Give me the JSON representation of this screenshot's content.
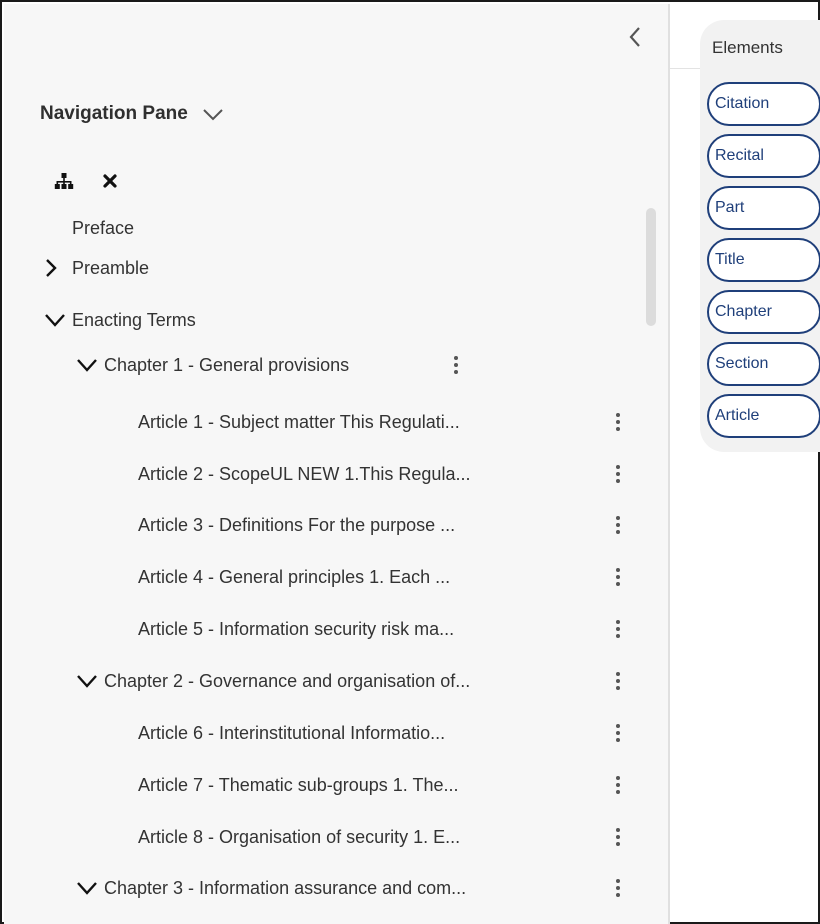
{
  "nav_pane": {
    "title": "Navigation Pane",
    "icons": {
      "collapse": "chevron-left-icon",
      "title_toggle": "chevron-down-icon",
      "structure": "sitemap-icon",
      "close": "close-icon"
    },
    "tree": {
      "preface": "Preface",
      "preamble": "Preamble",
      "enacting_terms": "Enacting Terms",
      "chapters": [
        {
          "label": "Chapter 1 - General provisions",
          "articles": [
            "Article 1 - Subject matter This Regulati...",
            "Article 2 - ScopeUL NEW 1.This Regula...",
            "Article 3 - Definitions For the purpose ...",
            "Article 4 - General principles  1. Each ...",
            "Article 5 - Information security risk ma..."
          ]
        },
        {
          "label": "Chapter 2 - Governance and organisation of...",
          "articles": [
            "Article 6 - Interinstitutional Informatio...",
            "Article 7 - Thematic sub-groups 1. The...",
            "Article 8 - Organisation of security 1. E..."
          ]
        },
        {
          "label": "Chapter 3 - Information assurance and com...",
          "articles": []
        }
      ]
    }
  },
  "elements_panel": {
    "title": "Elements",
    "items": [
      "Citation",
      "Recital",
      "Part",
      "Title",
      "Chapter",
      "Section",
      "Article"
    ]
  },
  "colors": {
    "pill_border": "#1f3f7a",
    "pane_background": "#f7f7f7",
    "panel_background": "#f2f2f2"
  }
}
